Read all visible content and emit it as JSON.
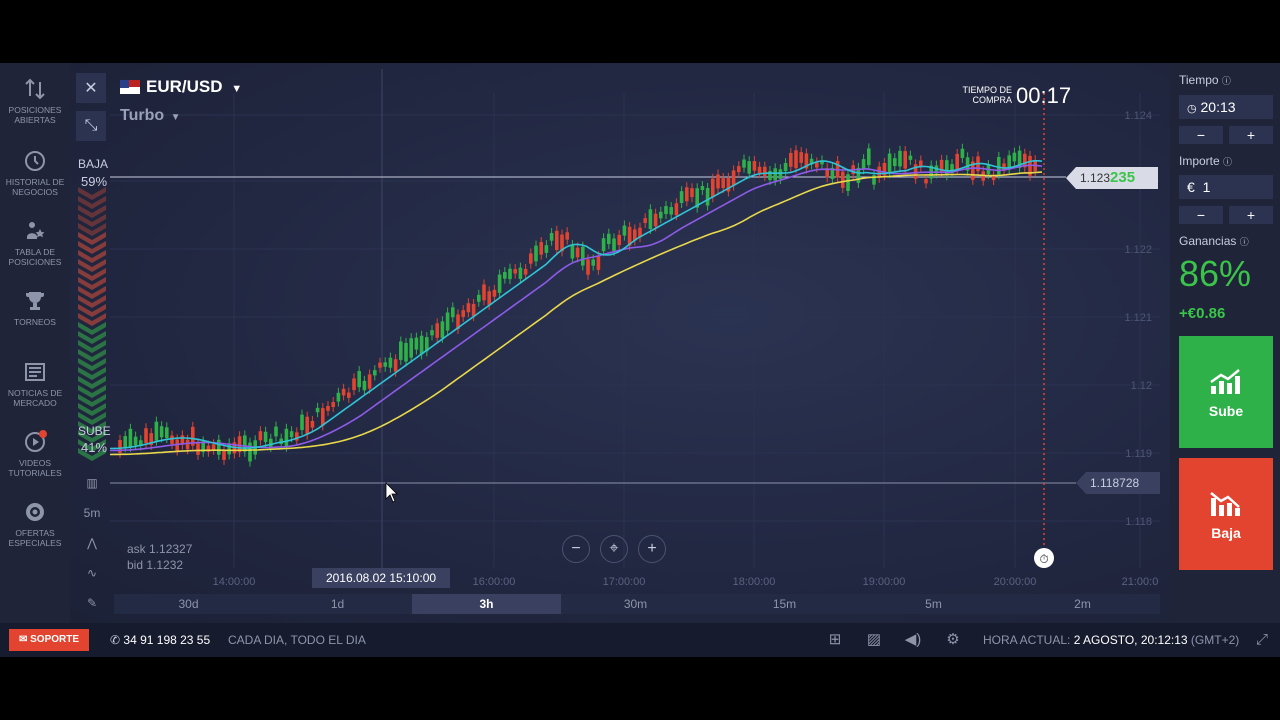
{
  "sidebar": {
    "items": [
      {
        "label": "POSICIONES ABIERTAS",
        "icon": "swap-arrows-icon"
      },
      {
        "label": "HISTORIAL DE NEGOCIOS",
        "icon": "history-clock-icon"
      },
      {
        "label": "TABLA DE POSICIONES",
        "icon": "leaderboard-icon"
      },
      {
        "label": "TORNEOS",
        "icon": "trophy-icon"
      },
      {
        "label": "NOTICIAS DE MERCADO",
        "icon": "news-icon"
      },
      {
        "label": "VIDEOS TUTORIALES",
        "icon": "video-play-icon",
        "badge": "1"
      },
      {
        "label": "OFERTAS ESPECIALES",
        "icon": "offer-badge-icon"
      }
    ]
  },
  "chart_header": {
    "pair": "EUR/USD",
    "mode": "Turbo",
    "timer_label_1": "TIEMPO DE",
    "timer_label_2": "COMPRA",
    "timer": "00:17"
  },
  "sentiment": {
    "down_label": "BAJA",
    "down_pct": "59%",
    "up_label": "SUBE",
    "up_pct": "41%"
  },
  "side_tools": {
    "interval": "5m"
  },
  "price": {
    "current_prefix": "1.123",
    "current_suffix": "235",
    "line_value": "1.118728",
    "ask": "ask 1.12327",
    "bid": "bid 1.1232"
  },
  "axis": {
    "y_ticks": [
      "1.124",
      "1.123",
      "1.122",
      "1.121",
      "1.12",
      "1.119",
      "1.118"
    ],
    "x_ticks": [
      "14:00:00",
      "16:00:00",
      "17:00:00",
      "18:00:00",
      "19:00:00",
      "20:00:00",
      "21:00:0"
    ],
    "cursor_date": "2016.08.02 15:10:00"
  },
  "periods": [
    "30d",
    "1d",
    "3h",
    "30m",
    "15m",
    "5m",
    "2m"
  ],
  "active_period": "3h",
  "right_panel": {
    "time_label": "Tiempo",
    "time_value": "20:13",
    "amount_label": "Importe",
    "amount_currency": "€",
    "amount_value": "1",
    "gain_label": "Ganancias",
    "gain_pct": "86%",
    "gain_value": "+€0.86",
    "up_button": "Sube",
    "down_button": "Baja",
    "minus": "−",
    "plus": "+"
  },
  "bottom_bar": {
    "support": "SOPORTE",
    "phone": "34 91 198 23 55",
    "hours": "CADA DIA, TODO EL DIA",
    "clock_label": "HORA ACTUAL:",
    "clock_value": "2 AGOSTO, 20:12:13",
    "timezone": "(GMT+2)"
  },
  "colors": {
    "up": "#2fb14a",
    "down": "#e2442f",
    "ma_fast": "#2fc4d6",
    "ma_mid": "#8d5be8",
    "ma_slow": "#e8d84a"
  }
}
